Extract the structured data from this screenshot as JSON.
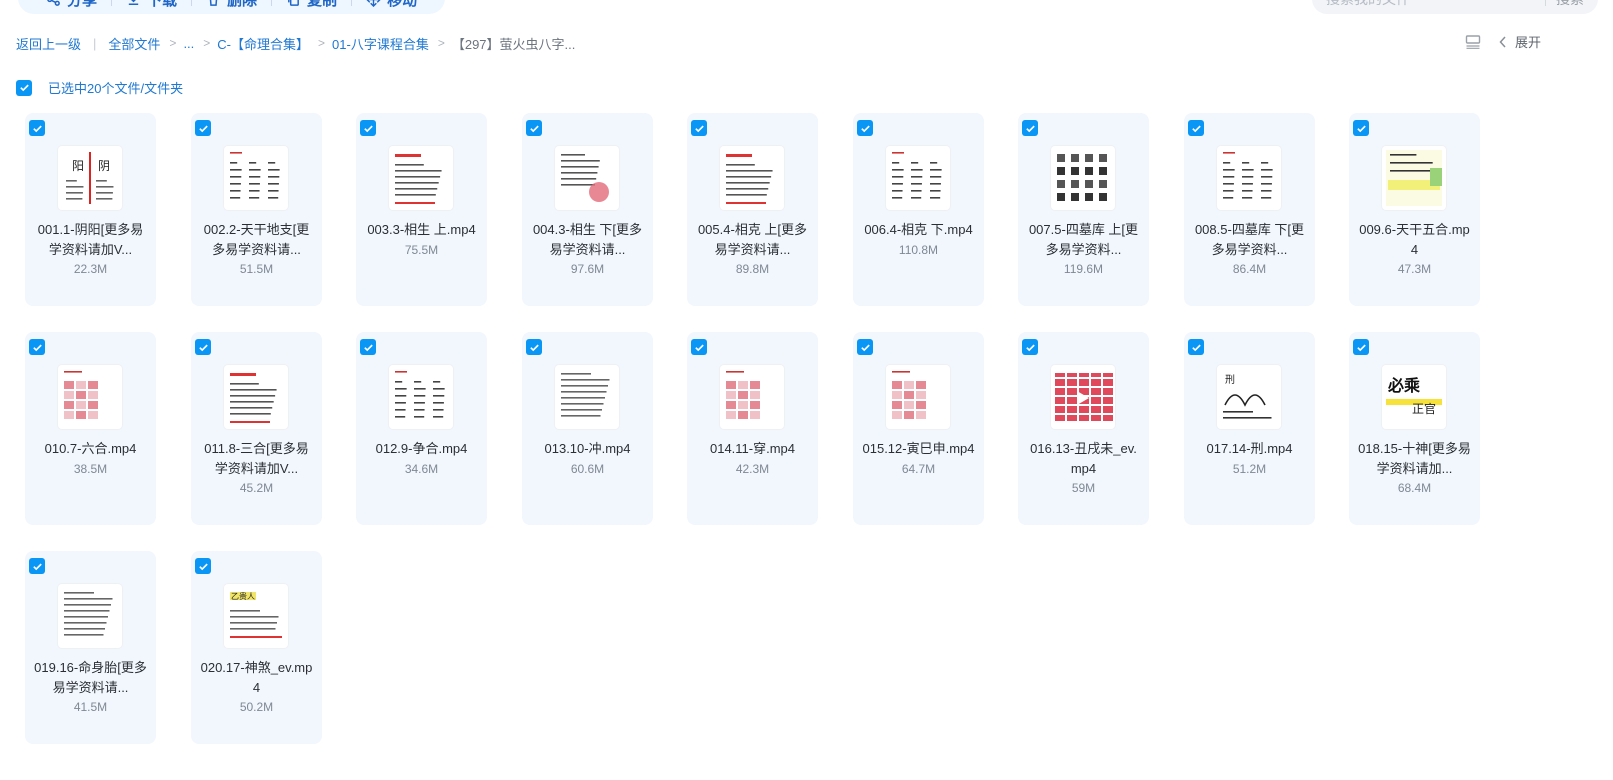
{
  "toolbar": {
    "share": "分享",
    "download": "下载",
    "delete": "删除",
    "copy": "复制",
    "move": "移动"
  },
  "search": {
    "placeholder": "搜索我的文件",
    "button": "搜索"
  },
  "breadcrumb": {
    "back": "返回上一级",
    "all_files": "全部文件",
    "ellipsis": "...",
    "level1": "C-【命理合集】",
    "level2": "01-八字课程合集",
    "current": "【297】萤火虫八字..."
  },
  "view": {
    "expand": "展开"
  },
  "selection": {
    "label": "已选中20个文件/文件夹",
    "checked": true
  },
  "colors": {
    "accent": "#0a96f5",
    "link": "#1f78d1",
    "card_bg": "#f1f7fd"
  },
  "files": [
    {
      "name": "001.1-阴阳[更多易学资料请加V...",
      "size": "22.3M",
      "thumb": "yinyang"
    },
    {
      "name": "002.2-天干地支[更多易学资料请...",
      "size": "51.5M",
      "thumb": "columns"
    },
    {
      "name": "003.3-相生 上.mp4",
      "size": "75.5M",
      "thumb": "textred"
    },
    {
      "name": "004.3-相生 下[更多易学资料请...",
      "size": "97.6M",
      "thumb": "textseal"
    },
    {
      "name": "005.4-相克 上[更多易学资料请...",
      "size": "89.8M",
      "thumb": "textred"
    },
    {
      "name": "006.4-相克 下.mp4",
      "size": "110.8M",
      "thumb": "columns"
    },
    {
      "name": "007.5-四墓库 上[更多易学资料...",
      "size": "119.6M",
      "thumb": "bigchars"
    },
    {
      "name": "008.5-四墓库 下[更多易学资料...",
      "size": "86.4M",
      "thumb": "columns"
    },
    {
      "name": "009.6-天干五合.mp4",
      "size": "47.3M",
      "thumb": "yellow"
    },
    {
      "name": "010.7-六合.mp4",
      "size": "38.5M",
      "thumb": "pinkgrid"
    },
    {
      "name": "011.8-三合[更多易学资料请加V...",
      "size": "45.2M",
      "thumb": "textred"
    },
    {
      "name": "012.9-争合.mp4",
      "size": "34.6M",
      "thumb": "columns"
    },
    {
      "name": "013.10-冲.mp4",
      "size": "60.6M",
      "thumb": "textplain"
    },
    {
      "name": "014.11-穿.mp4",
      "size": "42.3M",
      "thumb": "pinkgrid"
    },
    {
      "name": "015.12-寅巳申.mp4",
      "size": "64.7M",
      "thumb": "pinkgrid"
    },
    {
      "name": "016.13-丑戌未_ev.mp4",
      "size": "59M",
      "thumb": "redblocks"
    },
    {
      "name": "017.14-刑.mp4",
      "size": "51.2M",
      "thumb": "hand"
    },
    {
      "name": "018.15-十神[更多易学资料请加...",
      "size": "68.4M",
      "thumb": "calli"
    },
    {
      "name": "019.16-命身胎[更多易学资料请...",
      "size": "41.5M",
      "thumb": "textplain"
    },
    {
      "name": "020.17-神煞_ev.mp4",
      "size": "50.2M",
      "thumb": "yellowtitle"
    }
  ]
}
